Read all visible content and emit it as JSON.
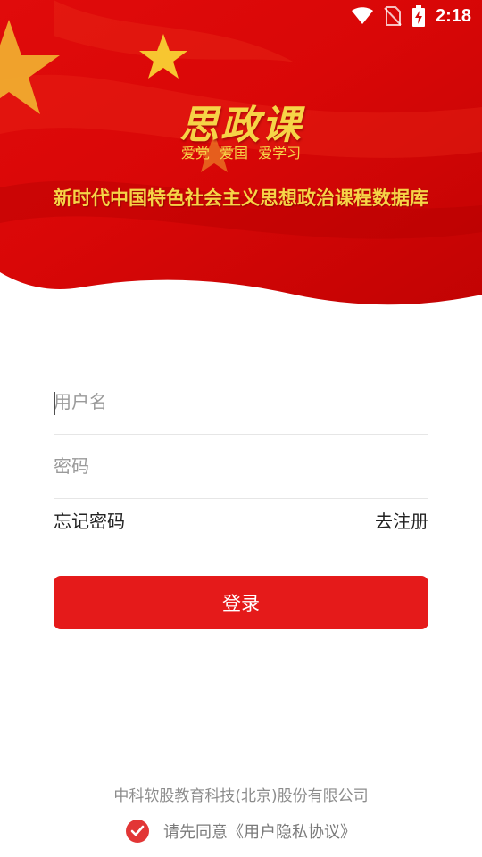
{
  "status_bar": {
    "time": "2:18"
  },
  "brand": {
    "logo_text": "思政课",
    "slogan": "爱党 爱国 爱学习",
    "subtitle": "新时代中国特色社会主义思想政治课程数据库"
  },
  "form": {
    "username_placeholder": "用户名",
    "password_placeholder": "密码",
    "forgot_password": "忘记密码",
    "register": "去注册",
    "login_button": "登录"
  },
  "footer": {
    "company": "中科软股教育科技(北京)股份有限公司",
    "agreement": "请先同意《用户隐私协议》",
    "agreement_checked": true
  },
  "colors": {
    "primary_red": "#e51a1a",
    "banner_gold": "#f6d447"
  }
}
